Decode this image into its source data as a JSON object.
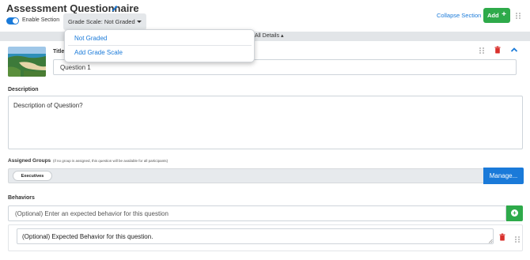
{
  "header": {
    "title": "Assessment Questionnaire",
    "enable_label": "Enable Section",
    "grade_scale_label": "Grade Scale:  Not Graded",
    "collapse_section": "Collapse Section",
    "add_button": "Add"
  },
  "band": {
    "collapse_all": "se All Details ▴"
  },
  "dropdown": {
    "items": [
      "Not Graded",
      "Add Grade Scale"
    ]
  },
  "question": {
    "title_label": "Title",
    "title_value": "Question 1",
    "description_label": "Description",
    "description_value": "Description of Question?"
  },
  "groups": {
    "label": "Assigned Groups",
    "hint": "(if no group is assigned, this question will be available for all participants)",
    "chip": "Executives",
    "manage_button": "Manage..."
  },
  "behaviors": {
    "label": "Behaviors",
    "input_placeholder": "(Optional) Enter an expected behavior for this question",
    "item_value": "(Optional) Expected Behavior for this question."
  },
  "colors": {
    "accent_blue": "#1a7ad9",
    "add_green": "#2eaa4a",
    "delete_red": "#d9302c"
  },
  "icons": [
    "pencil-icon",
    "toggle-switch",
    "caret-down-icon",
    "plus-icon",
    "drag-handle-icon",
    "trash-icon",
    "chevron-up-icon",
    "plus-circle-icon",
    "resize-handle-icon"
  ]
}
